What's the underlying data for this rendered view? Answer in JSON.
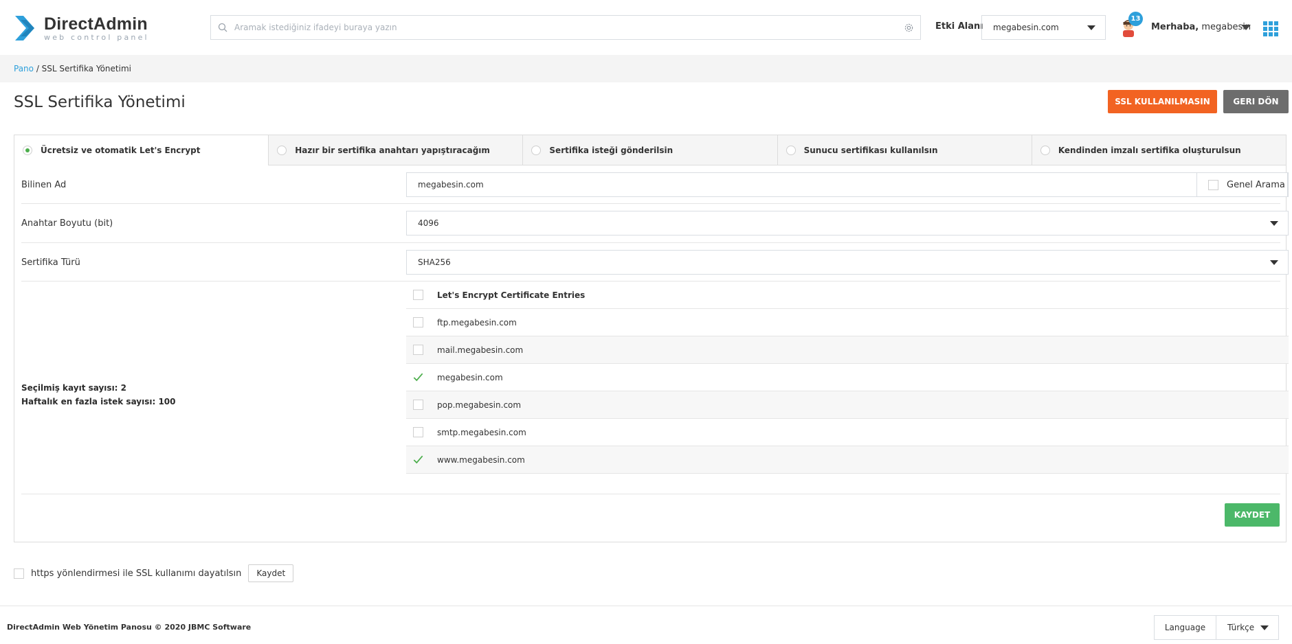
{
  "brand": {
    "name": "DirectAdmin",
    "tagline": "web control panel",
    "color": "#2ea0db"
  },
  "header": {
    "search_placeholder": "Aramak istediğiniz ifadeyi buraya yazın",
    "domain_label": "Etki Alanı",
    "domain_value": "megabesin.com",
    "notification_count": "13",
    "greeting_prefix": "Merhaba,",
    "username": "megabesin",
    "icons": [
      "search-icon",
      "gear-icon",
      "chevron-down-icon",
      "avatar",
      "apps-grid-icon"
    ]
  },
  "breadcrumb": {
    "home": "Pano",
    "separator": " / ",
    "current": "SSL Sertifika Yönetimi"
  },
  "page": {
    "title": "SSL Sertifika Yönetimi",
    "disable_ssl_label": "SSL KULLANILMASIN",
    "back_label": "GERI DÖN"
  },
  "tabs": [
    {
      "label": "Ücretsiz ve otomatik Let's Encrypt",
      "selected": true
    },
    {
      "label": "Hazır bir sertifika anahtarı yapıştıracağım",
      "selected": false
    },
    {
      "label": "Sertifika isteği gönderilsin",
      "selected": false
    },
    {
      "label": "Sunucu sertifikası kullanılsın",
      "selected": false
    },
    {
      "label": "Kendinden imzalı sertifika oluşturulsun",
      "selected": false
    }
  ],
  "form": {
    "common_name_label": "Bilinen Ad",
    "common_name_value": "megabesin.com",
    "wildcard_label": "Genel Arama",
    "key_size_label": "Anahtar Boyutu (bit)",
    "key_size_value": "4096",
    "cert_type_label": "Sertifika Türü",
    "cert_type_value": "SHA256",
    "selected_count_text": "Seçilmiş kayıt sayısı: 2",
    "weekly_limit_text": "Haftalık en fazla istek sayısı: 100",
    "entries_header": "Let's Encrypt Certificate Entries",
    "entries": [
      {
        "name": "ftp.megabesin.com",
        "checked": false
      },
      {
        "name": "mail.megabesin.com",
        "checked": false
      },
      {
        "name": "megabesin.com",
        "checked": true
      },
      {
        "name": "pop.megabesin.com",
        "checked": false
      },
      {
        "name": "smtp.megabesin.com",
        "checked": false
      },
      {
        "name": "www.megabesin.com",
        "checked": true
      }
    ],
    "save_label": "KAYDET"
  },
  "https_redirect": {
    "label": "https yönlendirmesi ile SSL kullanımı dayatılsın",
    "save_label": "Kaydet"
  },
  "footer": {
    "copyright": "DirectAdmin Web Yönetim Panosu © 2020 JBMC Software",
    "language_label": "Language",
    "language_value": "Türkçe"
  },
  "colors": {
    "accent": "#2ea0db",
    "orange": "#f26322",
    "gray_button": "#6d6d6d",
    "green": "#4cb869",
    "check_green": "#4cae4c"
  }
}
